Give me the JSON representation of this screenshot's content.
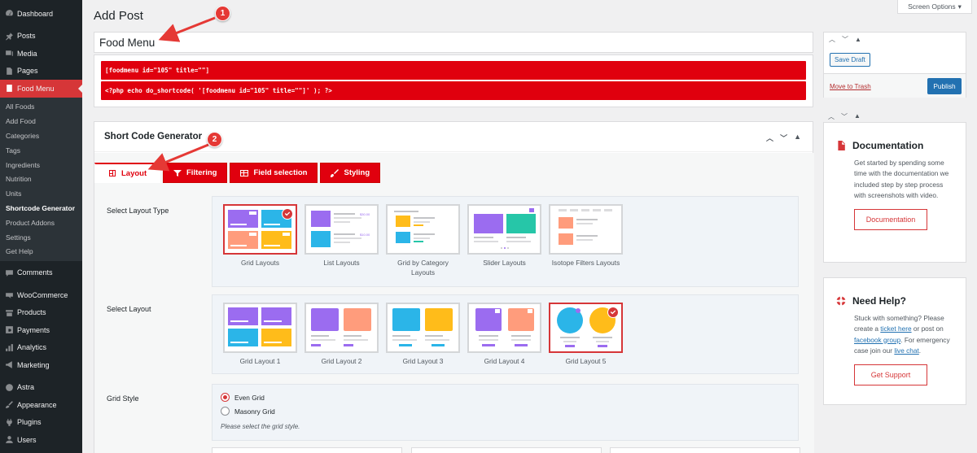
{
  "sidebar": {
    "top_items": [
      {
        "label": "Dashboard",
        "icon": "dashboard-icon"
      },
      {
        "label": "Posts",
        "icon": "pin-icon"
      },
      {
        "label": "Media",
        "icon": "media-icon"
      },
      {
        "label": "Pages",
        "icon": "pages-icon"
      },
      {
        "label": "Food Menu",
        "icon": "food-menu-icon",
        "active": true
      }
    ],
    "submenu": [
      "All Foods",
      "Add Food",
      "Categories",
      "Tags",
      "Ingredients",
      "Nutrition",
      "Units",
      "Shortcode Generator",
      "Product Addons",
      "Settings",
      "Get Help"
    ],
    "current_sub": "Shortcode Generator",
    "bottom_items": [
      {
        "label": "Comments",
        "icon": "comments-icon"
      },
      {
        "label": "WooCommerce",
        "icon": "woocommerce-icon"
      },
      {
        "label": "Products",
        "icon": "products-icon"
      },
      {
        "label": "Payments",
        "icon": "payments-icon"
      },
      {
        "label": "Analytics",
        "icon": "analytics-icon"
      },
      {
        "label": "Marketing",
        "icon": "marketing-icon"
      },
      {
        "label": "Astra",
        "icon": "astra-icon"
      },
      {
        "label": "Appearance",
        "icon": "appearance-icon"
      },
      {
        "label": "Plugins",
        "icon": "plugins-icon"
      },
      {
        "label": "Users",
        "icon": "users-icon"
      }
    ]
  },
  "header": {
    "title": "Add Post",
    "screen_options": "Screen Options"
  },
  "post": {
    "title": "Food Menu",
    "shortcode": "[foodmenu id=\"105\" title=\"\"]",
    "php": "<?php echo do_shortcode( '[foodmenu id=\"105\" title=\"\"]' ); ?>"
  },
  "generator": {
    "title": "Short Code Generator",
    "tabs": [
      "Layout",
      "Filtering",
      "Field selection",
      "Styling"
    ],
    "layout_type_label": "Select Layout Type",
    "layout_types": [
      "Grid Layouts",
      "List Layouts",
      "Grid by Category Layouts",
      "Slider Layouts",
      "Isotope Filters Layouts"
    ],
    "layout_label": "Select Layout",
    "layouts": [
      "Grid Layout 1",
      "Grid Layout 2",
      "Grid Layout 3",
      "Grid Layout 4",
      "Grid Layout 5"
    ],
    "grid_style_label": "Grid Style",
    "grid_styles": [
      "Even Grid",
      "Masonry Grid"
    ],
    "grid_hint": "Please select the grid style."
  },
  "publish": {
    "save_draft": "Save Draft",
    "trash": "Move to Trash",
    "publish": "Publish"
  },
  "documentation": {
    "title": "Documentation",
    "text": "Get started by spending some time with the documentation we included step by step process with screenshots with video.",
    "button": "Documentation"
  },
  "help": {
    "title": "Need Help?",
    "text_1": "Stuck with something? Please create a ",
    "link_1": "ticket here",
    "text_2": " or post on ",
    "link_2": "facebook group",
    "text_3": ". For emergency case join our ",
    "link_3": "live chat",
    "text_4": ".",
    "button": "Get Support"
  },
  "annotations": [
    "1",
    "2"
  ],
  "colors": {
    "accent": "#e0000e",
    "wp_dark": "#1d2327",
    "wp_blue": "#2271b1"
  }
}
